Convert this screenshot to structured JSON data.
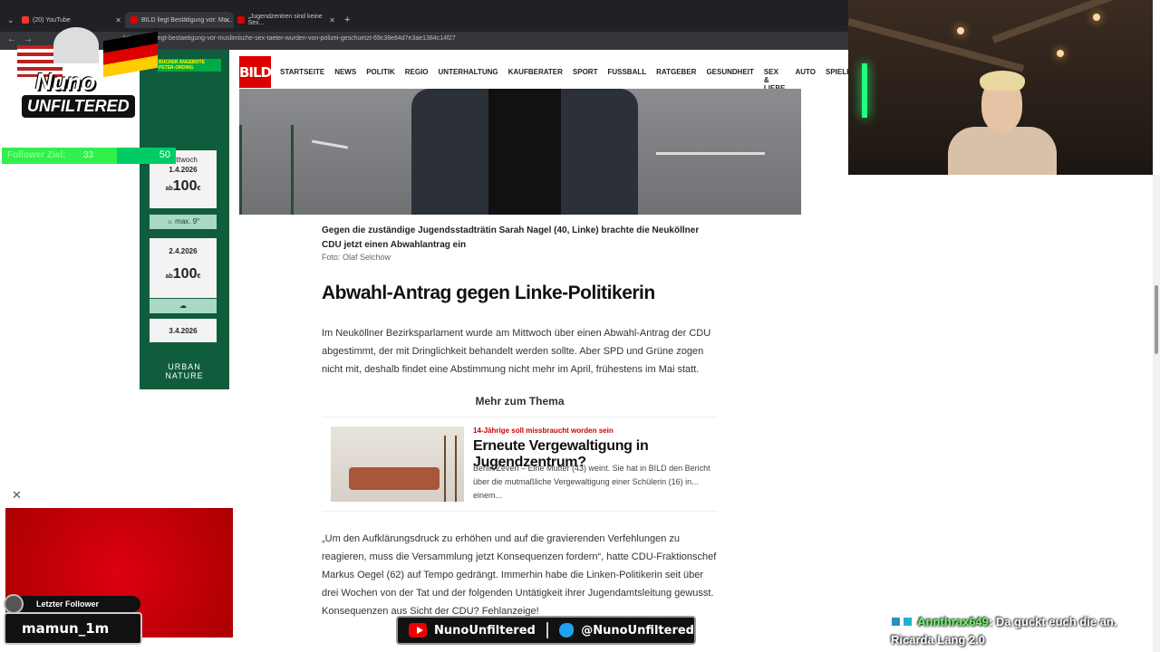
{
  "browser": {
    "tabs": [
      {
        "label": "(20) YouTube",
        "color": "#ff3333"
      },
      {
        "label": "BILD liegt Bestätigung vor: Mu...",
        "color": "#d00000"
      },
      {
        "label": "„Jugendzentren sind keine Sex...",
        "color": "#d00000"
      }
    ],
    "new_tab": "+",
    "url": "/inland/bild-liegt-bestaetigung-vor-muslimische-sex-taeter-wurden-von-polizei-geschuetzt-69c38e84d7e3ae1384c14f27"
  },
  "bild": {
    "logo": "BILD",
    "nav": [
      "STARTSEITE",
      "NEWS",
      "POLITIK",
      "REGIO",
      "UNTERHALTUNG",
      "KAUFBERATER",
      "SPORT",
      "FUSSBALL",
      "RATGEBER",
      "GESUNDHEIT",
      "SEX & LIEBE",
      "AUTO",
      "SPIELE"
    ]
  },
  "article": {
    "caption": "Gegen die zuständige Jugendsstadträtin Sarah Nagel (40, Linke) brachte die Neuköllner CDU jetzt einen Abwahlantrag ein",
    "credit": "Foto: Olaf Selchow",
    "heading": "Abwahl-Antrag gegen Linke-Politikerin",
    "paragraph1": "Im Neuköllner Bezirksparlament wurde am Mittwoch über einen Abwahl-Antrag der CDU abgestimmt, der mit Dringlichkeit behandelt werden sollte. Aber SPD und Grüne zogen nicht mit, deshalb findet eine Abstimmung nicht mehr im April, frühestens im Mai statt.",
    "more_heading": "Mehr zum Thema",
    "teaser": {
      "kicker": "14-Jährige soll missbraucht worden sein",
      "title": "Erneute Vergewaltigung in Jugendzentrum?",
      "desc": "Berlin/Zeven – Eine Mutter (43) weint. Sie hat in BILD den Bericht über die mutmaßliche Vergewaltigung einer Schülerin (16) in... einem..."
    },
    "paragraph2": "„Um den Aufklärungsdruck zu erhöhen und auf die gravierenden Verfehlungen zu reagieren, muss die Versammlung jetzt Konsequenzen fordern“, hatte CDU-Fraktionschef Markus Oegel (62) auf Tempo gedrängt. Immerhin habe die Linken-Politikerin seit über drei Wochen von der Tat und der folgenden Untätigkeit ihrer Jugendamtsleitung gewusst. Konsequenzen aus Sicht der CDU? Fehlanzeige!"
  },
  "ad": {
    "banner1": "BUCHER ANGEBOTE",
    "banner2": "PETER-ORDING",
    "cards": [
      {
        "day": "Mittwoch",
        "date": "1.4.2026",
        "prefix": "ab",
        "price": "100",
        "currency": "€",
        "weather": "max. 9°"
      },
      {
        "day": "",
        "date": "2.4.2026",
        "prefix": "ab",
        "price": "100",
        "currency": "€",
        "weather": "☁"
      },
      {
        "day": "",
        "date": "3.4.2026",
        "prefix": "",
        "price": "",
        "currency": "",
        "weather": ""
      }
    ],
    "brand_line1": "URBAN",
    "brand_line2": "NATURE"
  },
  "stream": {
    "logo_line1": "Nuno",
    "logo_line2": "UNFILTERED",
    "follower_goal_label": "Follower Ziel:",
    "follower_current": 33,
    "follower_goal": 50,
    "last_follower_label": "Letzter Follower",
    "last_follower_name": "mamun_1m",
    "social_youtube": "NunoUnfiltered",
    "social_twitter": "@NunoUnfiltered",
    "chat_user": "Annthrax649",
    "chat_message": ": Da guckt euch die an. Ricarda Lang 2.0"
  },
  "colors": {
    "bild_red": "#dd0000",
    "ad_green": "#0f5d3d",
    "goal_green": "#00cc66"
  }
}
